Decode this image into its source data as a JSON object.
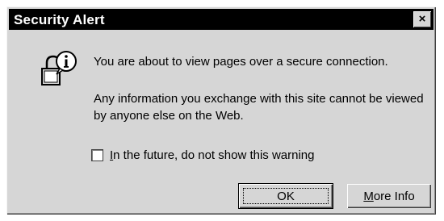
{
  "window": {
    "title": "Security Alert",
    "close_glyph": "×"
  },
  "icon": {
    "name": "info-lock-icon"
  },
  "message": {
    "line1": "You are about to view pages over a secure connection.",
    "line2": "Any information you exchange with this site cannot be viewed by anyone else on the Web."
  },
  "checkbox": {
    "label_underlined": "I",
    "label_rest": "n the future, do not show this warning",
    "checked": false
  },
  "buttons": {
    "ok_label": "OK",
    "more_info_label_underlined": "M",
    "more_info_label_rest": "ore Info"
  }
}
